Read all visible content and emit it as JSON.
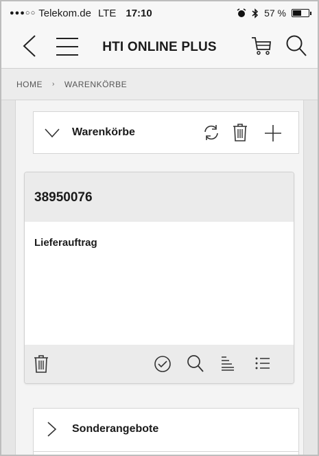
{
  "status_bar": {
    "signal": "●●●○○",
    "carrier": "Telekom.de",
    "network": "LTE",
    "time": "17:10",
    "battery": "57 %",
    "battery_level": 0.57
  },
  "nav": {
    "title": "HTI ONLINE PLUS"
  },
  "breadcrumb": {
    "home": "HOME",
    "separator": "›",
    "current": "WARENKÖRBE"
  },
  "sections": {
    "warenkoerbe": {
      "title": "Warenkörbe"
    },
    "sonderangebote": {
      "title": "Sonderangebote"
    }
  },
  "cart": {
    "number": "38950076",
    "description": "Lieferauftrag"
  },
  "colors": {
    "background": "#e6e6e6",
    "card_header": "#ebebeb",
    "icon": "#333333"
  }
}
